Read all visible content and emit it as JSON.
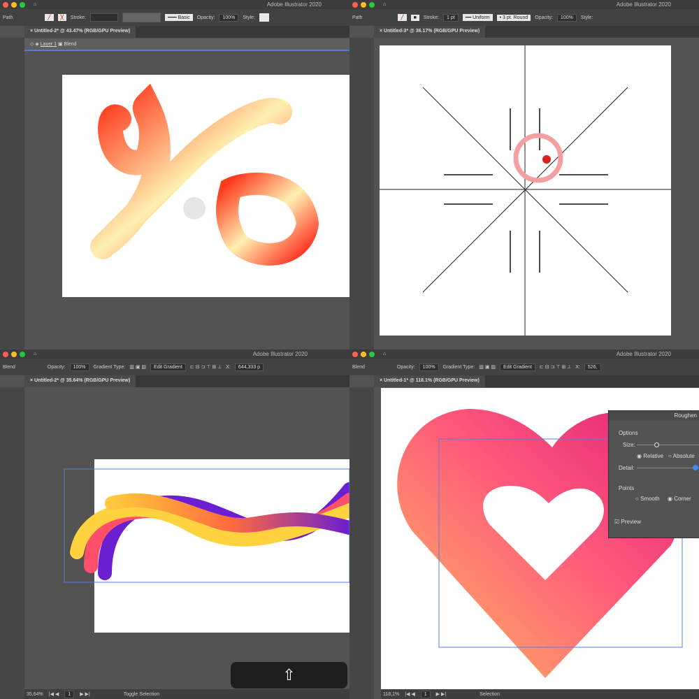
{
  "app_title": "Adobe Illustrator 2020",
  "panels": [
    {
      "selection": "Path",
      "stroke_label": "Stroke:",
      "brush": "Basic",
      "opacity_label": "Opacity:",
      "opacity": "100%",
      "style_label": "Style:",
      "tab": "Untitled-2* @ 43.47% (RGB/GPU Preview)",
      "breadcrumb_layer": "Layer 1",
      "breadcrumb_item": "Blend"
    },
    {
      "selection": "Path",
      "stroke_label": "Stroke:",
      "stroke_weight": "1 pt",
      "profile": "Uniform",
      "brush": "3 pt. Round",
      "opacity_label": "Opacity:",
      "opacity": "100%",
      "style_label": "Style:",
      "tab": "Untitled-3* @ 36.17% (RGB/GPU Preview)"
    },
    {
      "selection": "Blend",
      "opacity_label": "Opacity:",
      "opacity": "100%",
      "gradient_type_label": "Gradient Type:",
      "edit_gradient": "Edit Gradient",
      "x_label": "X:",
      "x_value": "644,333 p",
      "tab": "Untitled-2* @ 35.64% (RGB/GPU Preview)",
      "zoom": "35,64%",
      "page": "1",
      "status": "Toggle Selection",
      "key_icon": "⇧"
    },
    {
      "selection": "Blend",
      "opacity_label": "Opacity:",
      "opacity": "100%",
      "gradient_type_label": "Gradient Type:",
      "edit_gradient": "Edit Gradient",
      "x_label": "X:",
      "x_value": "526,",
      "tab": "Untitled-1* @ 118.1% (RGB/GPU Preview)",
      "zoom": "118,1%",
      "page": "1",
      "status": "Selection",
      "dialog": {
        "title": "Roughen",
        "options": "Options",
        "size": "Size:",
        "relative": "Relative",
        "absolute": "Absolute",
        "detail": "Detail:",
        "points": "Points",
        "smooth": "Smooth",
        "corner": "Corner",
        "preview": "Preview",
        "size_value": 0.25,
        "detail_value": 0.98
      }
    }
  ]
}
